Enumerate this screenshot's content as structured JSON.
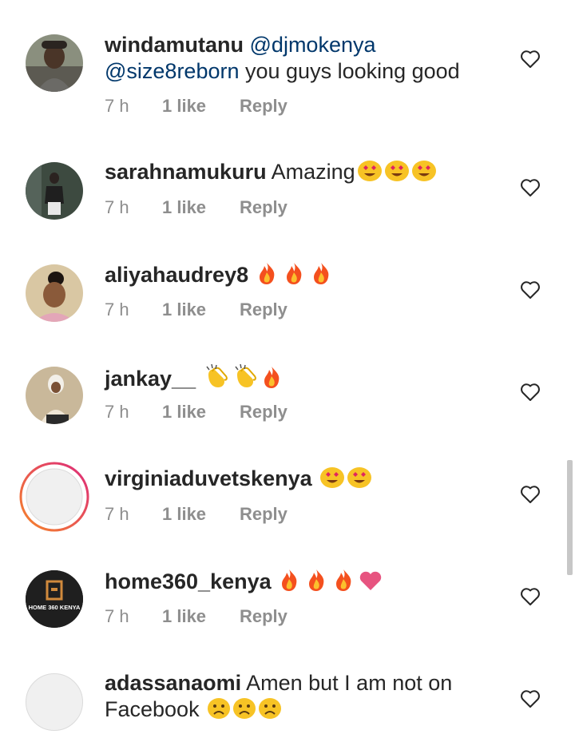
{
  "comments": [
    {
      "username": "windamutanu",
      "mention1": "@djmokenya",
      "mention2": "@size8reborn",
      "text": " you guys looking good",
      "time": "7 h",
      "likes": "1 like",
      "reply": "Reply"
    },
    {
      "username": "sarahnamukuru",
      "text": "Amazing",
      "emojis": [
        "heart-eyes",
        "heart-eyes",
        "heart-eyes"
      ],
      "time": "7 h",
      "likes": "1 like",
      "reply": "Reply"
    },
    {
      "username": "aliyahaudrey8",
      "text": "",
      "emojis": [
        "fire",
        "fire",
        "fire"
      ],
      "time": "7 h",
      "likes": "1 like",
      "reply": "Reply"
    },
    {
      "username": "jankay__",
      "text": "",
      "emojis": [
        "clap",
        "clap",
        "fire"
      ],
      "time": "7 h",
      "likes": "1 like",
      "reply": "Reply"
    },
    {
      "username": "virginiaduvetskenya",
      "text": "",
      "emojis": [
        "heart-eyes",
        "heart-eyes"
      ],
      "time": "7 h",
      "likes": "1 like",
      "reply": "Reply"
    },
    {
      "username": "home360_kenya",
      "text": "",
      "emojis": [
        "fire",
        "fire",
        "fire",
        "pink-heart"
      ],
      "avatar_logo_text": "HOME 360 KENYA",
      "time": "7 h",
      "likes": "1 like",
      "reply": "Reply"
    },
    {
      "username": "adassanaomi",
      "text": "Amen but I am not on",
      "text_line2": "Facebook",
      "emojis": [
        "frown",
        "frown",
        "frown"
      ]
    }
  ],
  "colors": {
    "username": "#262626",
    "mention": "#00376b",
    "meta": "#8e8e8e",
    "story_ring_start": "#f58529",
    "story_ring_end": "#dd2a7b"
  }
}
